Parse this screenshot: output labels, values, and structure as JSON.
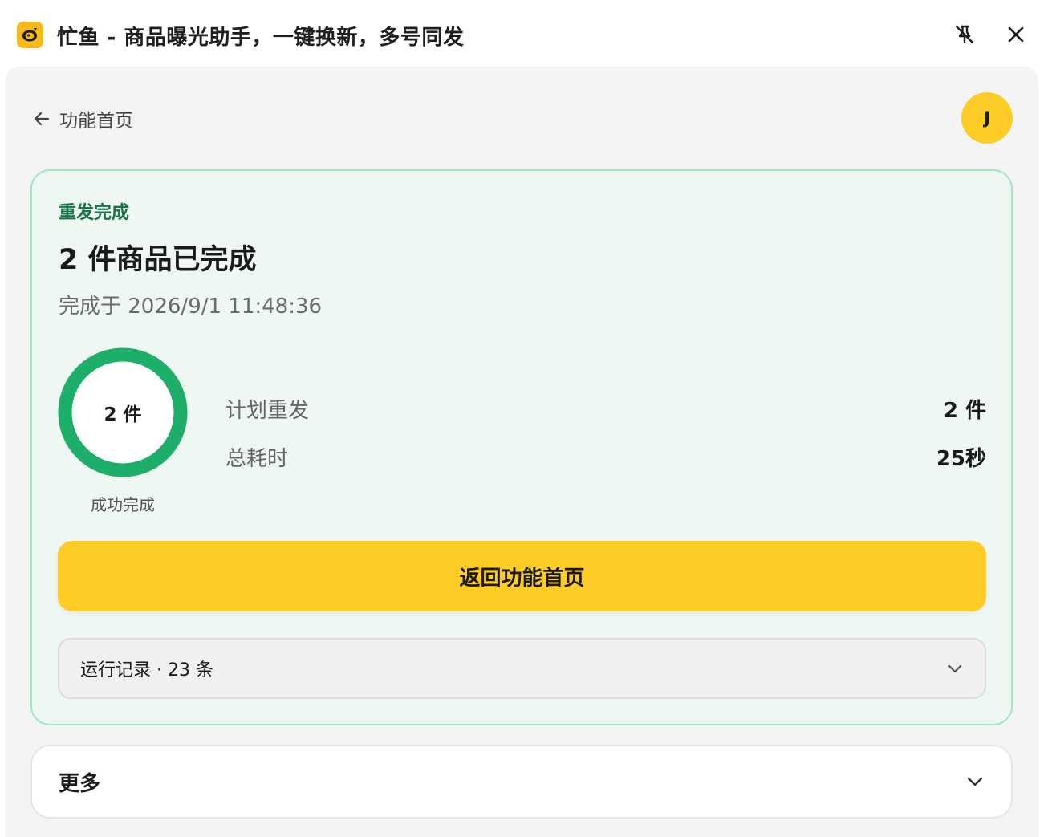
{
  "window": {
    "title": "忙鱼 - 商品曝光助手，一键换新，多号同发",
    "logo_icon": "fish-logo-icon",
    "pin_icon": "pin-off-icon",
    "close_icon": "close-icon"
  },
  "nav": {
    "back_label": "功能首页",
    "avatar_initial": "J"
  },
  "result": {
    "eyebrow": "重发完成",
    "headline": "2 件商品已完成",
    "completed_at": "完成于 2026/9/1 11:48:36",
    "ring": {
      "value_text": "2 件",
      "caption": "成功完成",
      "progress_fraction": 1.0,
      "color": "#1daf6a"
    },
    "stats": [
      {
        "label": "计划重发",
        "value": "2 件"
      },
      {
        "label": "总耗时",
        "value": "25秒"
      }
    ],
    "primary_button": "返回功能首页",
    "log_summary": "运行记录 · 23 条"
  },
  "more": {
    "label": "更多"
  },
  "colors": {
    "accent_yellow": "#fdcc26",
    "success_green": "#1daf6a",
    "success_bg": "#eef7f1",
    "success_border": "#9ee9bf",
    "eyebrow_green": "#17744a"
  }
}
